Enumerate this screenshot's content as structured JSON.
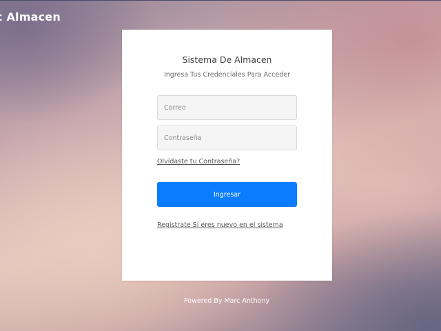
{
  "header": {
    "brand": "c Almacen"
  },
  "login": {
    "title": "Sistema De Almacen",
    "subtitle": "Ingresa Tus Credenciales Para Acceder",
    "email_placeholder": "Correo",
    "email_value": "",
    "password_placeholder": "Contraseña",
    "password_value": "",
    "forgot_link": "Olvidaste tu Contraseña?",
    "submit_label": "Ingresar",
    "register_link": "Registrate Si eres nuevo en el sistema"
  },
  "footer": {
    "text": "Powered By Marc Anthony"
  },
  "colors": {
    "primary_button": "#0a7cff",
    "card_background": "#ffffff",
    "input_background": "#f5f5f5"
  }
}
